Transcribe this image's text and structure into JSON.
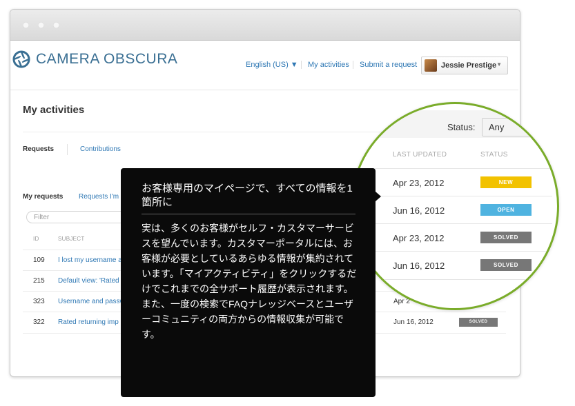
{
  "app": {
    "brand": "CAMERA OBSCURA",
    "nav": {
      "language": "English (US) ▼",
      "my_activities": "My activities",
      "submit_request": "Submit a request"
    },
    "user": {
      "name": "Jessie Prestige"
    }
  },
  "page": {
    "title": "My activities",
    "tabs": [
      "Requests",
      "Contributions"
    ],
    "subtabs": [
      "My requests",
      "Requests I'm"
    ],
    "filter_placeholder": "Filter",
    "columns": {
      "id": "ID",
      "subject": "SUBJECT"
    },
    "rows": [
      {
        "id": "109",
        "subject": "I lost my username a",
        "date": "",
        "status": ""
      },
      {
        "id": "215",
        "subject": "Default view: 'Rated",
        "date": "",
        "status": ""
      },
      {
        "id": "323",
        "subject": "Username and passw",
        "date": "Apr 2",
        "status": ""
      },
      {
        "id": "322",
        "subject": "Rated  returning imp",
        "date": "Jun 16, 2012",
        "status": "SOLVED"
      }
    ]
  },
  "lens": {
    "status_label": "Status:",
    "status_value": "Any",
    "col_last_updated": "LAST UPDATED",
    "col_status": "STATUS",
    "rows": [
      {
        "date": "Apr 23, 2012",
        "status": "NEW",
        "color": "#f2c200"
      },
      {
        "date": "Jun 16, 2012",
        "status": "OPEN",
        "color": "#4fb3e0"
      },
      {
        "date": "Apr 23, 2012",
        "status": "SOLVED",
        "color": "#777777"
      },
      {
        "date": "Jun 16, 2012",
        "status": "SOLVED",
        "color": "#777777"
      }
    ]
  },
  "callout": {
    "title": "お客様専用のマイページで、すべての情報を1箇所に",
    "body": "実は、多くのお客様がセルフ・カスタマーサービスを望んでいます。カスタマーポータルには、お客様が必要としているあらゆる情報が集約されています。「マイアクティビティ」をクリックするだけでこれまでの全サポート履歴が表示されます。また、一度の検索でFAQナレッジベースとユーザーコミュニティの両方からの情報収集が可能です。"
  },
  "colors": {
    "accent": "#7aac2a",
    "link": "#2f78b4",
    "brand": "#3a6f93"
  }
}
